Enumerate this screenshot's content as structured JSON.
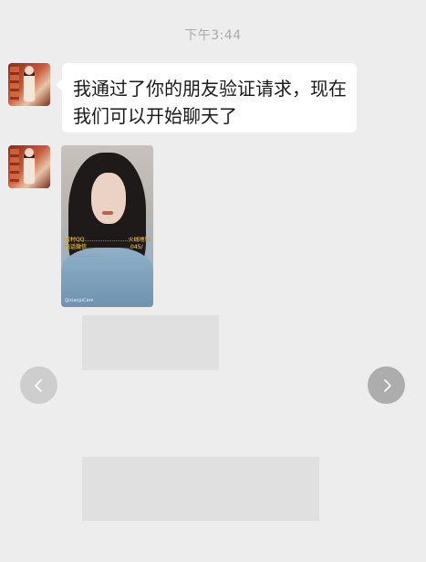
{
  "timestamp": "下午3:44",
  "messages": [
    {
      "type": "text",
      "lines": [
        "我通过了你的朋友验证请求，现在",
        "我们可以开始聊天了"
      ]
    },
    {
      "type": "image",
      "overlay_lines": [
        "看村QQ……………………火线地铁",
        "电话微信……………………045/",
        "…………………"
      ],
      "tag": "@xiaojuCam"
    }
  ],
  "nav": {
    "prev_icon": "chevron-left-icon",
    "next_icon": "chevron-right-icon"
  },
  "colors": {
    "background": "#ededed",
    "bubble": "#ffffff",
    "timestamp": "#a9a9a9"
  }
}
